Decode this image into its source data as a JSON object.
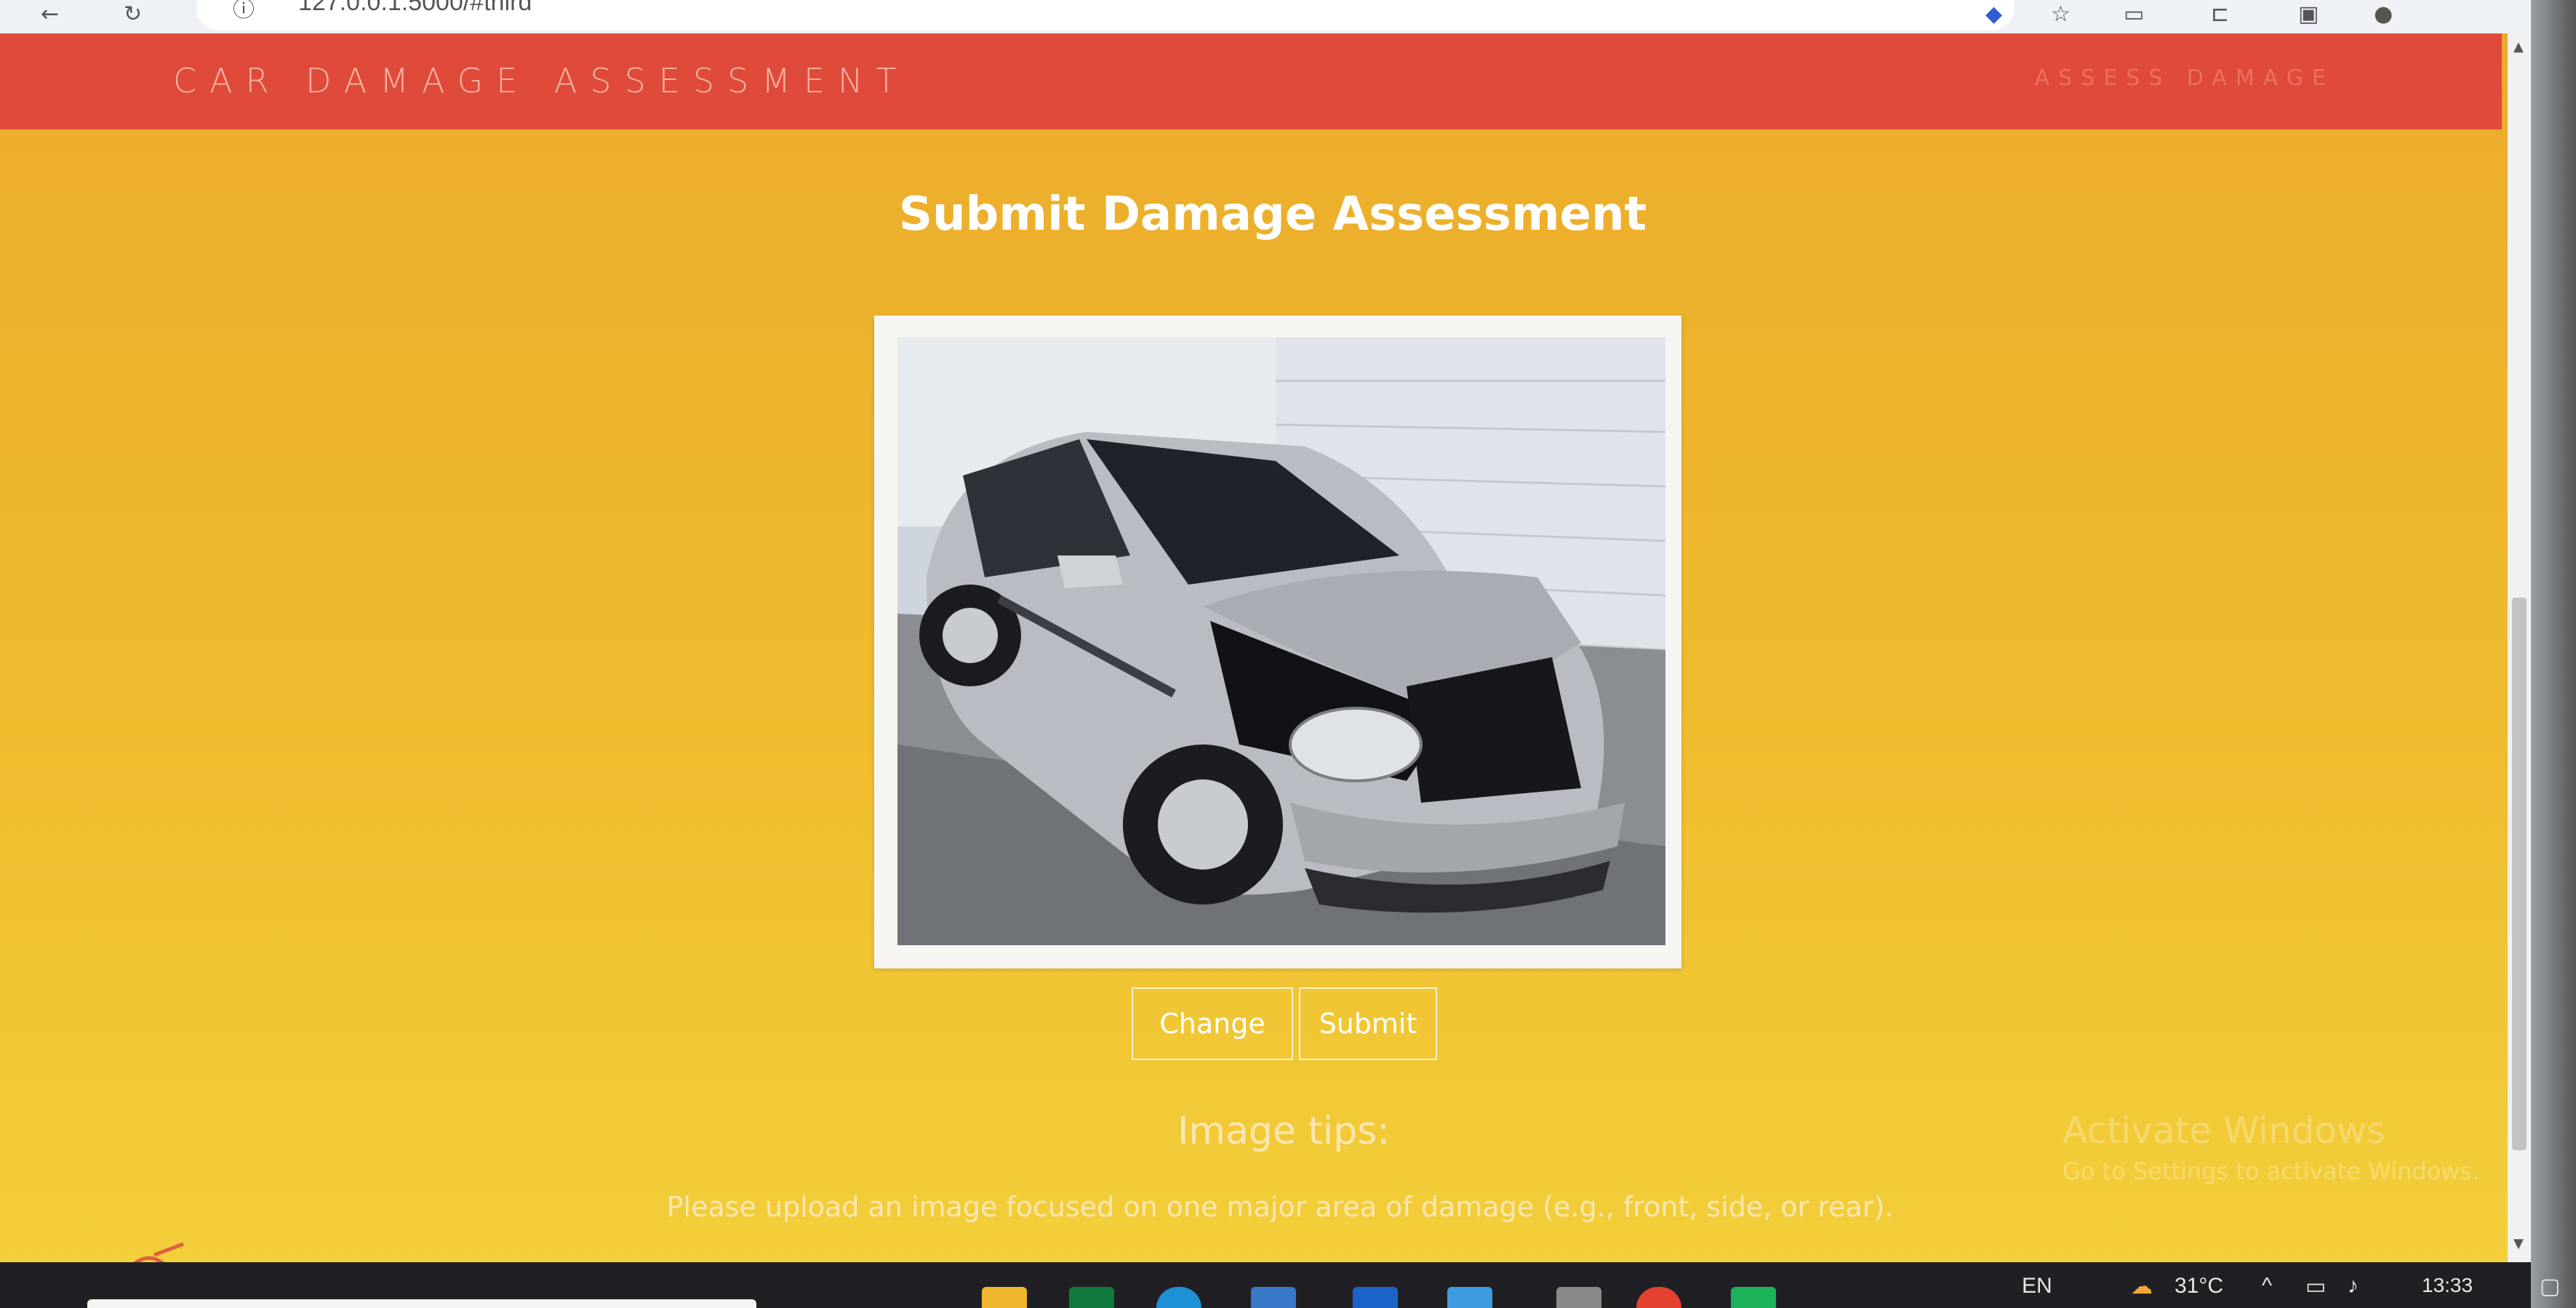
{
  "browser": {
    "url": "127.0.0.1:5000/#third"
  },
  "navbar": {
    "brand": "CAR DAMAGE ASSESSMENT",
    "link": "ASSESS DAMAGE"
  },
  "main": {
    "title": "Submit Damage Assessment",
    "buttons": {
      "change": "Change",
      "submit": "Submit"
    },
    "tips": {
      "title": "Image tips:",
      "text": "Please upload an image focused on one major area of damage (e.g., front, side, or rear)."
    }
  },
  "watermark": {
    "line1": "Activate Windows",
    "line2": "Go to Settings to activate Windows."
  },
  "taskbar": {
    "language": "EN",
    "temperature": "31°C",
    "time": "13:33"
  },
  "colors": {
    "navbar": "#e04a3a",
    "background_top": "#ecac2b",
    "background_bottom": "#f3cf3a"
  }
}
